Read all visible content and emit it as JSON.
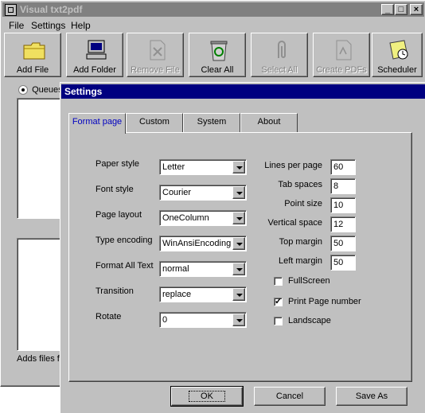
{
  "window": {
    "title": "Visual txt2pdf",
    "icon": "app-icon"
  },
  "title_buttons": {
    "minimize": "_",
    "maximize": "□",
    "close": "×"
  },
  "menu": [
    "File",
    "Settings",
    "Help"
  ],
  "toolbar": [
    {
      "label": "Add File",
      "icon": "folder-icon",
      "enabled": true
    },
    {
      "label": "Add Folder",
      "icon": "computer-icon",
      "enabled": true
    },
    {
      "label": "Remove File",
      "icon": "document-remove-icon",
      "enabled": false
    },
    {
      "label": "Clear All",
      "icon": "recycle-bin-icon",
      "enabled": true
    },
    {
      "label": "Select All",
      "icon": "paperclip-icon",
      "enabled": false
    },
    {
      "label": "Create PDFs",
      "icon": "pdf-document-icon",
      "enabled": false
    },
    {
      "label": "Scheduler",
      "icon": "scheduler-clock-icon",
      "enabled": true
    }
  ],
  "queues": {
    "label": "Queues",
    "status": "Adds files fr"
  },
  "dialog": {
    "title": "Settings",
    "tabs": [
      "Format page",
      "Custom",
      "System",
      "About"
    ],
    "active_tab": "Format page",
    "fields": [
      {
        "label": "Paper style",
        "value": "Letter"
      },
      {
        "label": "Font style",
        "value": "Courier"
      },
      {
        "label": "Page layout",
        "value": "OneColumn"
      },
      {
        "label": "Type encoding",
        "value": "WinAnsiEncoding"
      },
      {
        "label": "Format All Text",
        "value": "normal"
      },
      {
        "label": "Transition",
        "value": "replace"
      },
      {
        "label": "Rotate",
        "value": "0"
      }
    ],
    "numbers": [
      {
        "label": "Lines per page",
        "value": "60"
      },
      {
        "label": "Tab spaces",
        "value": "8"
      },
      {
        "label": "Point size",
        "value": "10"
      },
      {
        "label": "Vertical space",
        "value": "12"
      },
      {
        "label": "Top margin",
        "value": "50"
      },
      {
        "label": "Left margin",
        "value": "50"
      }
    ],
    "checkboxes": [
      {
        "label": "FullScreen",
        "checked": false
      },
      {
        "label": "Print Page number",
        "checked": true
      },
      {
        "label": "Landscape",
        "checked": false
      }
    ],
    "buttons": {
      "ok": "OK",
      "cancel": "Cancel",
      "save_as": "Save As"
    }
  }
}
